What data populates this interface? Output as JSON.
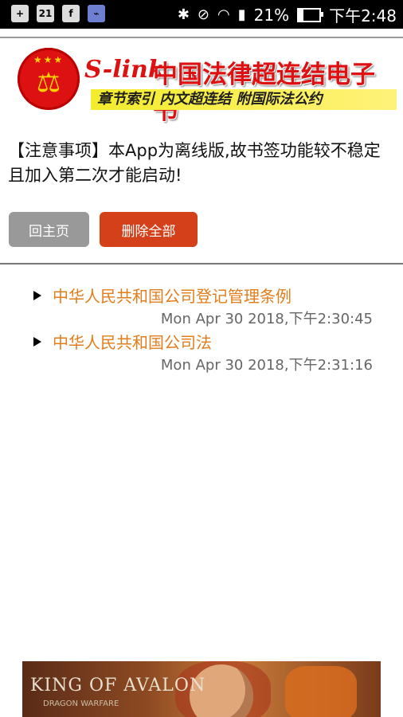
{
  "status_bar": {
    "battery": "21%",
    "time": "下午2:48",
    "left_icons": [
      "notification-icon",
      "twenty-one-icon",
      "facebook-icon",
      "broom-icon"
    ],
    "right_icons": [
      "bluetooth-icon",
      "mute-icon",
      "wifi-icon",
      "signal-icon",
      "battery-icon"
    ],
    "battery_level": 0.21
  },
  "header": {
    "brand": "S-link",
    "title": "中国法律超连结电子书",
    "slogan": "章节索引 内文超连结 附国际法公约"
  },
  "notice": "【注意事项】本App为离线版,故书签功能较不稳定且加入第二次才能启动!",
  "buttons": {
    "home": "回主页",
    "delete_all": "删除全部"
  },
  "bookmarks": [
    {
      "title": "中华人民共和国公司登记管理条例",
      "time": "Mon Apr 30 2018,下午2:30:45"
    },
    {
      "title": "中华人民共和国公司法",
      "time": "Mon Apr 30 2018,下午2:31:16"
    }
  ],
  "ad": {
    "logo": "KING OF AVALON",
    "tagline": "DRAGON WARFARE"
  },
  "colors": {
    "accent_red": "#d11111",
    "delete_button": "#d4401a",
    "link_orange": "#e37d1c",
    "gray_button": "#999999"
  }
}
